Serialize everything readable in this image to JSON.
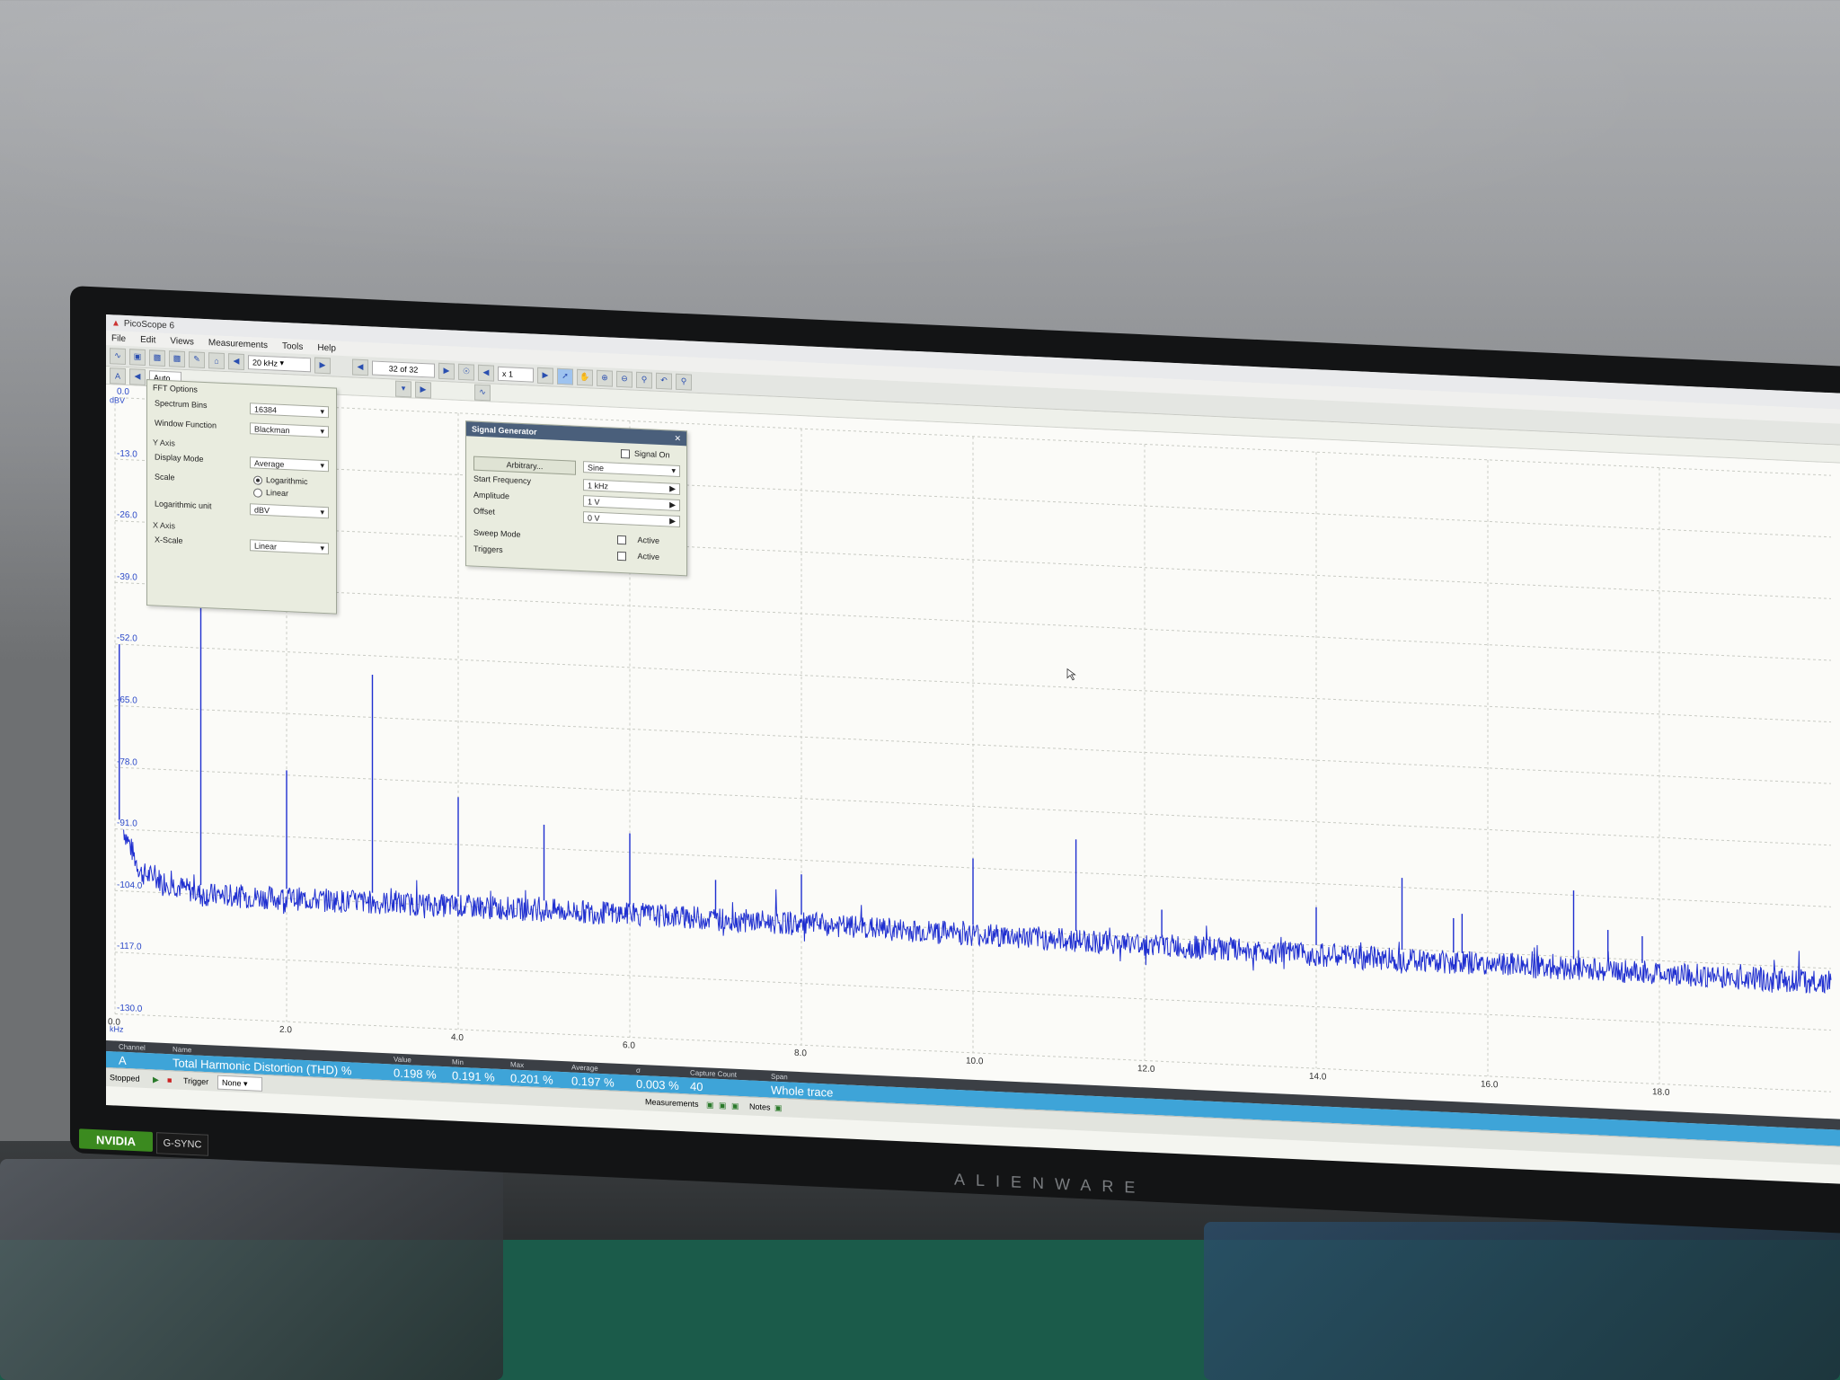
{
  "window": {
    "title": "PicoScope 6"
  },
  "menu": [
    "File",
    "Edit",
    "Views",
    "Measurements",
    "Tools",
    "Help"
  ],
  "toolbar": {
    "timebase": "20 kHz",
    "capture": "32 of 32",
    "zoom": "x 1",
    "range_auto": "Auto"
  },
  "fft_options": {
    "title": "FFT Options",
    "spectrum_bins_label": "Spectrum Bins",
    "spectrum_bins": "16384",
    "window_function_label": "Window Function",
    "window_function": "Blackman",
    "y_axis_label": "Y Axis",
    "display_mode_label": "Display Mode",
    "display_mode": "Average",
    "scale_label": "Scale",
    "scale_log": "Logarithmic",
    "scale_lin": "Linear",
    "log_unit_label": "Logarithmic unit",
    "log_unit": "dBV",
    "x_axis_label": "X Axis",
    "x_scale_label": "X-Scale",
    "x_scale": "Linear"
  },
  "signal_generator": {
    "title": "Signal Generator",
    "signal_on_label": "Signal On",
    "arbitrary_button": "Arbitrary...",
    "waveform": "Sine",
    "start_freq_label": "Start Frequency",
    "start_freq": "1 kHz",
    "amplitude_label": "Amplitude",
    "amplitude": "1 V",
    "offset_label": "Offset",
    "offset": "0 V",
    "sweep_label": "Sweep Mode",
    "sweep_active": "Active",
    "triggers_label": "Triggers",
    "triggers_active": "Active"
  },
  "chart_data": {
    "type": "line",
    "xlabel": "kHz",
    "ylabel": "dBV",
    "xlim": [
      0,
      20
    ],
    "ylim": [
      -130,
      0
    ],
    "y_ticks": [
      "0.0",
      "-13.0",
      "-26.0",
      "-39.0",
      "-52.0",
      "-65.0",
      "-78.0",
      "-91.0",
      "-104.0",
      "-117.0",
      "-130.0"
    ],
    "x_ticks": [
      "0.0",
      "2.0",
      "4.0",
      "6.0",
      "8.0",
      "10.0",
      "12.0",
      "14.0",
      "16.0",
      "18.0"
    ],
    "grid": true,
    "series": [
      {
        "noise_floor": [
          [
            0.1,
            -91
          ],
          [
            0.3,
            -100
          ],
          [
            1,
            -104
          ],
          [
            6,
            -104
          ],
          [
            10,
            -105
          ],
          [
            14,
            -106
          ],
          [
            20,
            -107
          ]
        ],
        "peaks": [
          {
            "x": 0.05,
            "y": -52
          },
          {
            "x": 1.0,
            "y": -5
          },
          {
            "x": 2.0,
            "y": -77
          },
          {
            "x": 3.0,
            "y": -56
          },
          {
            "x": 4.0,
            "y": -81
          },
          {
            "x": 5.0,
            "y": -86
          },
          {
            "x": 6.0,
            "y": -87
          },
          {
            "x": 7.0,
            "y": -96
          },
          {
            "x": 8.0,
            "y": -94
          },
          {
            "x": 10.0,
            "y": -89
          },
          {
            "x": 11.2,
            "y": -84
          },
          {
            "x": 12.2,
            "y": -98
          },
          {
            "x": 14.0,
            "y": -96
          },
          {
            "x": 15.0,
            "y": -89
          },
          {
            "x": 15.6,
            "y": -97
          },
          {
            "x": 15.7,
            "y": -96
          },
          {
            "x": 17.0,
            "y": -90
          },
          {
            "x": 17.4,
            "y": -98
          },
          {
            "x": 17.8,
            "y": -99
          }
        ]
      }
    ],
    "colors": {
      "trace": "#1f2fd0",
      "grid": "#c9cbc4"
    }
  },
  "measurements": {
    "headers": [
      "Channel",
      "Name",
      "Value",
      "Min",
      "Max",
      "Average",
      "σ",
      "Capture Count",
      "Span"
    ],
    "row": {
      "channel": "A",
      "name": "Total Harmonic Distortion (THD) %",
      "value": "0.198 %",
      "min": "0.191 %",
      "max": "0.201 %",
      "average": "0.197 %",
      "sigma": "0.003 %",
      "count": "40",
      "span": "Whole trace"
    }
  },
  "statusbar": {
    "state": "Stopped",
    "trigger_label": "Trigger",
    "trigger": "None",
    "measurements": "Measurements",
    "notes": "Notes"
  },
  "monitor": {
    "brand": "ALIENWARE",
    "nvidia": "NVIDIA",
    "gsync": "G-SYNC"
  }
}
